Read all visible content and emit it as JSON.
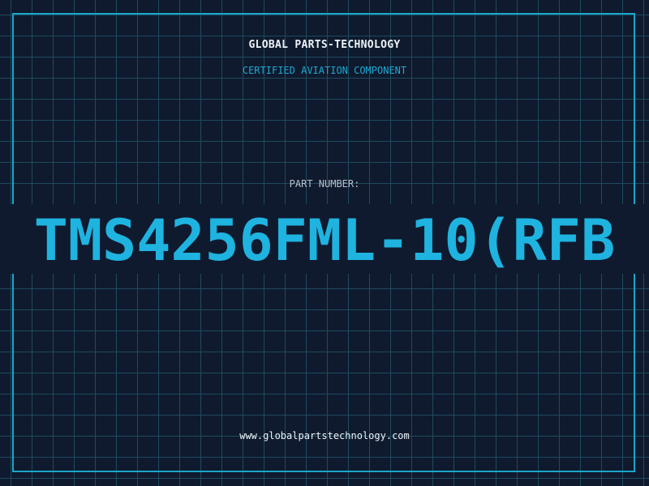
{
  "header": {
    "company": "GLOBAL PARTS-TECHNOLOGY",
    "tagline": "CERTIFIED AVIATION COMPONENT"
  },
  "part": {
    "label": "PART NUMBER:",
    "number": "TMS4256FML-10(RFB"
  },
  "footer": {
    "website": "www.globalpartstechnology.com"
  },
  "colors": {
    "background": "#0f1a2e",
    "grid": "#1f4a5e",
    "accent": "#1fb3e0",
    "text": "#eef3f8"
  }
}
